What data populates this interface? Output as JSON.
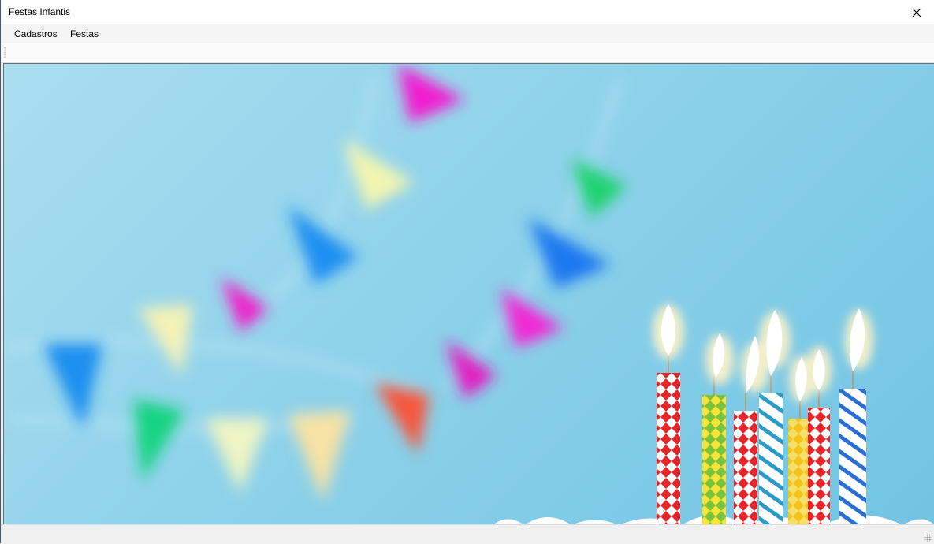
{
  "window": {
    "title": "Festas Infantis"
  },
  "menu": {
    "items": [
      "Cadastros",
      "Festas"
    ]
  },
  "icons": {
    "close": "close-icon",
    "toolbar_grip": "grip-icon",
    "size_grip": "resize-grip-icon"
  },
  "background_image": {
    "subject": "birthday candles and bunting",
    "dominant_color": "#8fd2ea"
  }
}
